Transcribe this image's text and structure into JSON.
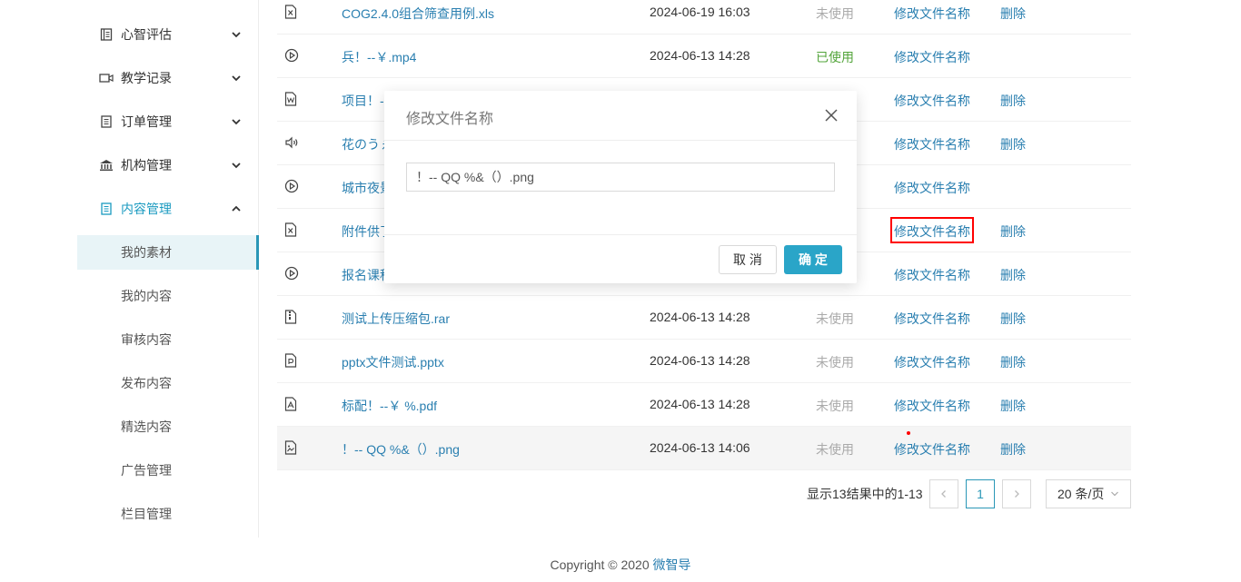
{
  "sidebar": {
    "menus": [
      {
        "label": "心智评估",
        "icon": "list-icon"
      },
      {
        "label": "教学记录",
        "icon": "video-icon"
      },
      {
        "label": "订单管理",
        "icon": "document-icon"
      },
      {
        "label": "机构管理",
        "icon": "bank-icon"
      },
      {
        "label": "内容管理",
        "icon": "document-icon"
      }
    ],
    "subitems": [
      "我的素材",
      "我的内容",
      "审核内容",
      "发布内容",
      "精选内容",
      "广告管理",
      "栏目管理"
    ]
  },
  "table": {
    "rows": [
      {
        "icon": "excel-file-icon",
        "name": "COG2.4.0组合筛查用例.xls",
        "date": "2024-06-19 16:03",
        "status": "未使用",
        "rename": "修改文件名称",
        "delete": "删除"
      },
      {
        "icon": "play-icon",
        "name": "兵！--￥.mp4",
        "date": "2024-06-13 14:28",
        "status": "已使用",
        "rename": "修改文件名称",
        "delete": ""
      },
      {
        "icon": "word-file-icon",
        "name": "项目！-",
        "date": "",
        "status": "",
        "rename": "修改文件名称",
        "delete": "删除"
      },
      {
        "icon": "audio-icon",
        "name": "花のうぇ",
        "date": "",
        "status": "",
        "rename": "修改文件名称",
        "delete": "删除"
      },
      {
        "icon": "play-icon",
        "name": "城市夜景",
        "date": "",
        "status": "",
        "rename": "修改文件名称",
        "delete": ""
      },
      {
        "icon": "excel-file-icon",
        "name": "附件供了",
        "date": "",
        "status": "",
        "rename": "修改文件名称",
        "delete": "删除"
      },
      {
        "icon": "play-icon",
        "name": "报名课程",
        "date": "",
        "status": "",
        "rename": "修改文件名称",
        "delete": "删除"
      },
      {
        "icon": "archive-file-icon",
        "name": "测试上传压缩包.rar",
        "date": "2024-06-13 14:28",
        "status": "未使用",
        "rename": "修改文件名称",
        "delete": "删除"
      },
      {
        "icon": "ppt-file-icon",
        "name": "pptx文件测试.pptx",
        "date": "2024-06-13 14:28",
        "status": "未使用",
        "rename": "修改文件名称",
        "delete": "删除"
      },
      {
        "icon": "pdf-file-icon",
        "name": "标配！--￥ %.pdf",
        "date": "2024-06-13 14:28",
        "status": "未使用",
        "rename": "修改文件名称",
        "delete": "删除"
      },
      {
        "icon": "image-file-icon",
        "name": "！-- QQ %&（）.png",
        "date": "2024-06-13 14:06",
        "status": "未使用",
        "rename": "修改文件名称",
        "delete": "删除"
      }
    ]
  },
  "pagination": {
    "info": "显示13结果中的1-13",
    "prev": "<",
    "page": "1",
    "next": ">",
    "page_size": "20 条/页"
  },
  "footer": {
    "copyright": "Copyright © 2020 ",
    "brand": "微智导"
  },
  "modal": {
    "title": "修改文件名称",
    "input_value": "！-- QQ %&（）.png",
    "cancel": "取 消",
    "ok": "确 定"
  },
  "colors": {
    "accent": "#2aa5c8",
    "link": "#2a7fb0",
    "used": "#52a43a"
  }
}
